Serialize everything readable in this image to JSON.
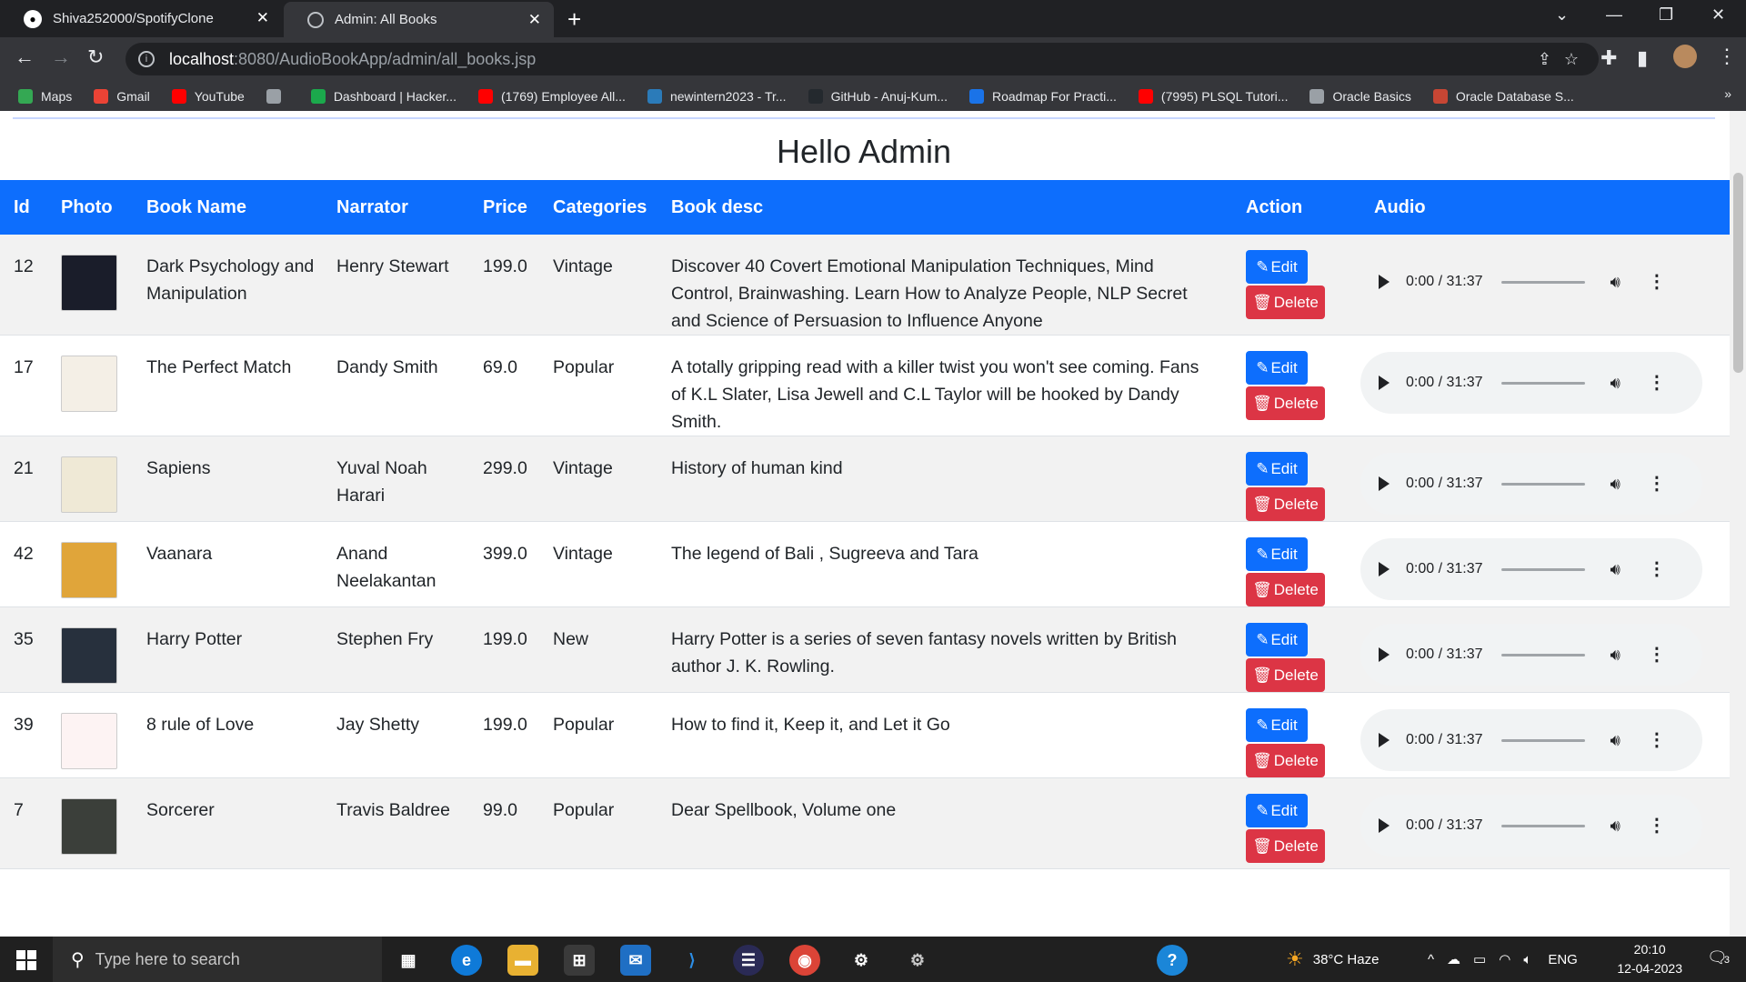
{
  "browser": {
    "tabs": [
      {
        "title": "Shiva252000/SpotifyClone",
        "icon": "github-icon",
        "active": false
      },
      {
        "title": "Admin: All Books",
        "icon": "globe-icon",
        "active": true
      }
    ],
    "address": {
      "host": "localhost",
      "path": ":8080/AudioBookApp/admin/all_books.jsp"
    },
    "bookmarks": [
      {
        "label": "Maps",
        "icon": "maps-icon",
        "color": "#34a853"
      },
      {
        "label": "Gmail",
        "icon": "gmail-icon",
        "color": "#ea4335"
      },
      {
        "label": "YouTube",
        "icon": "youtube-icon",
        "color": "#ff0000"
      },
      {
        "label": "",
        "icon": "globe-icon",
        "color": "#9aa0a6"
      },
      {
        "label": "Dashboard | Hacker...",
        "icon": "hackerrank-icon",
        "color": "#1ba94c"
      },
      {
        "label": "(1769) Employee All...",
        "icon": "youtube-icon",
        "color": "#ff0000"
      },
      {
        "label": "newintern2023 - Tr...",
        "icon": "sp-icon",
        "color": "#2b7bb9"
      },
      {
        "label": "GitHub - Anuj-Kum...",
        "icon": "github-icon",
        "color": "#24292e"
      },
      {
        "label": "Roadmap For Practi...",
        "icon": "infinity-icon",
        "color": "#1a73e8"
      },
      {
        "label": "(7995) PLSQL Tutori...",
        "icon": "youtube-icon",
        "color": "#ff0000"
      },
      {
        "label": "Oracle Basics",
        "icon": "globe-icon",
        "color": "#9aa0a6"
      },
      {
        "label": "Oracle Database S...",
        "icon": "oracle-icon",
        "color": "#c74634"
      }
    ],
    "bookmarks_more": "»"
  },
  "page": {
    "heading": "Hello Admin",
    "columns": [
      "Id",
      "Photo",
      "Book Name",
      "Narrator",
      "Price",
      "Categories",
      "Book desc",
      "Action",
      "Audio"
    ],
    "edit_label": "Edit",
    "delete_label": "Delete",
    "audio_time": "0:00 / 31:37",
    "books": [
      {
        "id": "12",
        "name": "Dark Psychology and Manipulation",
        "narrator": "Henry Stewart",
        "price": "199.0",
        "category": "Vintage",
        "desc": "Discover 40 Covert Emotional Manipulation Techniques, Mind Control, Brainwashing. Learn How to Analyze People, NLP Secret and Science of Persuasion to Influence Anyone",
        "cover": "#1a1d2a"
      },
      {
        "id": "17",
        "name": "The Perfect Match",
        "narrator": "Dandy Smith",
        "price": "69.0",
        "category": "Popular",
        "desc": "A totally gripping read with a killer twist you won't see coming. Fans of K.L Slater, Lisa Jewell and C.L Taylor will be hooked by Dandy Smith.",
        "cover": "#f4efe6"
      },
      {
        "id": "21",
        "name": "Sapiens",
        "narrator": "Yuval Noah Harari",
        "price": "299.0",
        "category": "Vintage",
        "desc": "History of human kind",
        "cover": "#efe9d6"
      },
      {
        "id": "42",
        "name": "Vaanara",
        "narrator": "Anand Neelakantan",
        "price": "399.0",
        "category": "Vintage",
        "desc": "The legend of Bali , Sugreeva and Tara",
        "cover": "#e0a53a"
      },
      {
        "id": "35",
        "name": "Harry Potter",
        "narrator": "Stephen Fry",
        "price": "199.0",
        "category": "New",
        "desc": "Harry Potter is a series of seven fantasy novels written by British author J. K. Rowling.",
        "cover": "#27303d"
      },
      {
        "id": "39",
        "name": "8 rule of Love",
        "narrator": "Jay Shetty",
        "price": "199.0",
        "category": "Popular",
        "desc": "How to find it, Keep it, and Let it Go",
        "cover": "#fdf3f3"
      },
      {
        "id": "7",
        "name": "Sorcerer",
        "narrator": "Travis Baldree",
        "price": "99.0",
        "category": "Popular",
        "desc": "Dear Spellbook, Volume one",
        "cover": "#3b3f3a"
      }
    ]
  },
  "taskbar": {
    "search_placeholder": "Type here to search",
    "weather": "38°C  Haze",
    "lang": "ENG",
    "time": "20:10",
    "date": "12-04-2023",
    "notifications": "3"
  }
}
